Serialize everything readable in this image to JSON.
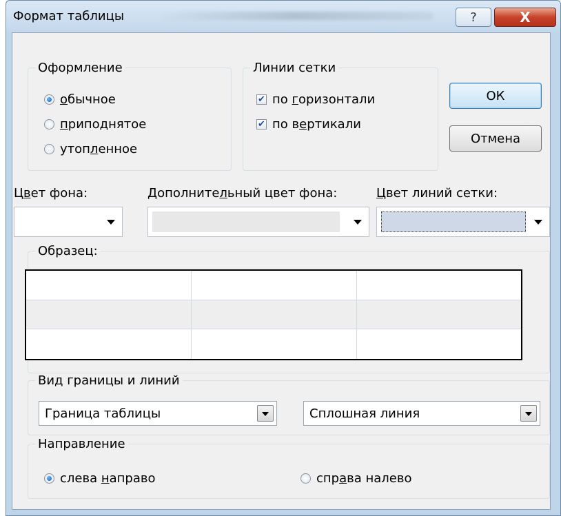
{
  "window": {
    "title": "Формат таблицы",
    "help_label": "?",
    "close_label": "X"
  },
  "design_group": {
    "legend": "Оформление",
    "options": [
      {
        "pre": "",
        "acc": "о",
        "post": "бычное",
        "selected": true
      },
      {
        "pre": "",
        "acc": "п",
        "post": "риподнятое",
        "selected": false
      },
      {
        "pre": "утоп",
        "acc": "л",
        "post": "енное",
        "selected": false
      }
    ]
  },
  "gridlines_group": {
    "legend": "Линии сетки",
    "options": [
      {
        "pre": "по ",
        "acc": "г",
        "post": "оризонтали",
        "checked": true
      },
      {
        "pre": "по в",
        "acc": "е",
        "post": "ртикали",
        "checked": true
      }
    ]
  },
  "buttons": {
    "ok": "ОК",
    "cancel": "Отмена"
  },
  "colors": {
    "background_label": {
      "pre": "Ц",
      "acc": "в",
      "post": "ет фона:"
    },
    "alt_background_label": {
      "pre": "Дополните",
      "acc": "л",
      "post": "ьный цвет фона:"
    },
    "gridline_label": {
      "pre": "",
      "acc": "Ц",
      "post": "вет линий сетки:"
    },
    "background_value": "#ffffff",
    "alt_background_value": "#eeeeee",
    "gridline_value": "#ced8e6"
  },
  "sample": {
    "legend": "Образец:"
  },
  "border_group": {
    "legend_pre": "Ви",
    "legend_acc": "д",
    "legend_post": " границы и линий",
    "border_select": "Граница таблицы",
    "line_select": "Сплошная линия"
  },
  "direction_group": {
    "legend": "Направление",
    "ltr": {
      "pre": "слева ",
      "acc": "н",
      "post": "аправо",
      "selected": true
    },
    "rtl": {
      "pre": "спр",
      "acc": "а",
      "post": "ва налево",
      "selected": false
    }
  }
}
